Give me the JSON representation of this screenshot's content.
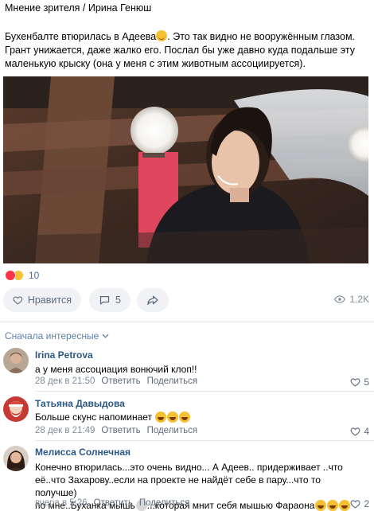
{
  "header": {
    "title": "Мнение зрителя / Ирина Генюш"
  },
  "post": {
    "text_part1": "Бухенбалте втюрилась в Адеева",
    "text_part2": ". Это так видно не вооружённым глазом. Грант унижается, даже жалко его. Послал бы уже давно куда подальше эту маленькую крыску (она у меня с этим животным ассоциируется).",
    "reactions_count": "10",
    "like_label": "Нравится",
    "comments_count": "5",
    "views": "1.2K"
  },
  "comments_section": {
    "sort_label": "Сначала интересные"
  },
  "comments": [
    {
      "author": "Irina Petrova",
      "text": "а у меня ассоциация вонючий клоп!!",
      "date": "28 дек в 21:50",
      "reply": "Ответить",
      "share": "Поделиться",
      "likes": "5"
    },
    {
      "author": "Татьяна Давыдова",
      "text": "Больше скунс напоминает",
      "date": "28 дек в 21:49",
      "reply": "Ответить",
      "share": "Поделиться",
      "likes": "4"
    },
    {
      "author": "Мелисса Солнечная",
      "text_line1": "Конечно втюрилась...это очень видно... А Адеев.. придерживает ..что",
      "text_line2": "её..что Захарову..если на проекте не найдёт себе в пару...что то получше)",
      "text_line3a": "по мне..Буханка мышь",
      "text_line3b": "...которая мнит себя мышью Фараона",
      "date": "вчера в 5:26",
      "reply": "Ответить",
      "share": "Поделиться",
      "likes": "2"
    }
  ],
  "colors": {
    "link": "#2a5885",
    "secondary": "#818c99",
    "button_bg": "#f0f2f5",
    "heart": "#ff3347"
  }
}
